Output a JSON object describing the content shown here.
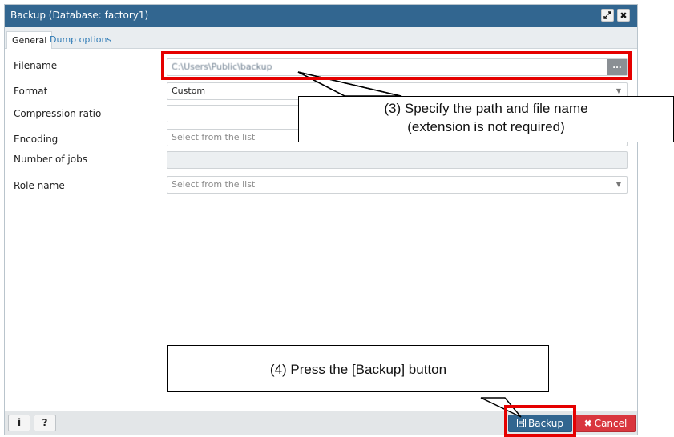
{
  "window": {
    "title": "Backup (Database: factory1)",
    "maximize_icon": "expand-icon",
    "close_label": "✖"
  },
  "tabs": [
    {
      "label": "General",
      "active": true
    },
    {
      "label": "Dump options",
      "active": false
    }
  ],
  "form": {
    "filename_label": "Filename",
    "filename_value": "C:\\Users\\Public\\backup",
    "browse_label": "...",
    "format_label": "Format",
    "format_value": "Custom",
    "compression_label": "Compression ratio",
    "compression_value": "",
    "encoding_label": "Encoding",
    "encoding_placeholder": "Select from the list",
    "jobs_label": "Number of jobs",
    "jobs_value": "",
    "role_label": "Role name",
    "role_placeholder": "Select from the list"
  },
  "footer": {
    "info_label": "i",
    "help_label": "?",
    "backup_label": "Backup",
    "cancel_label": "Cancel"
  },
  "annotations": {
    "callout1_line1": "(3) Specify the path and file name",
    "callout1_line2": "(extension is not required)",
    "callout2": "(4) Press the [Backup] button",
    "highlight_color": "#e50000"
  },
  "colors": {
    "titlebar": "#326690",
    "tab_link": "#2f7bb6",
    "backup_button": "#326690",
    "cancel_button": "#d9363e"
  }
}
